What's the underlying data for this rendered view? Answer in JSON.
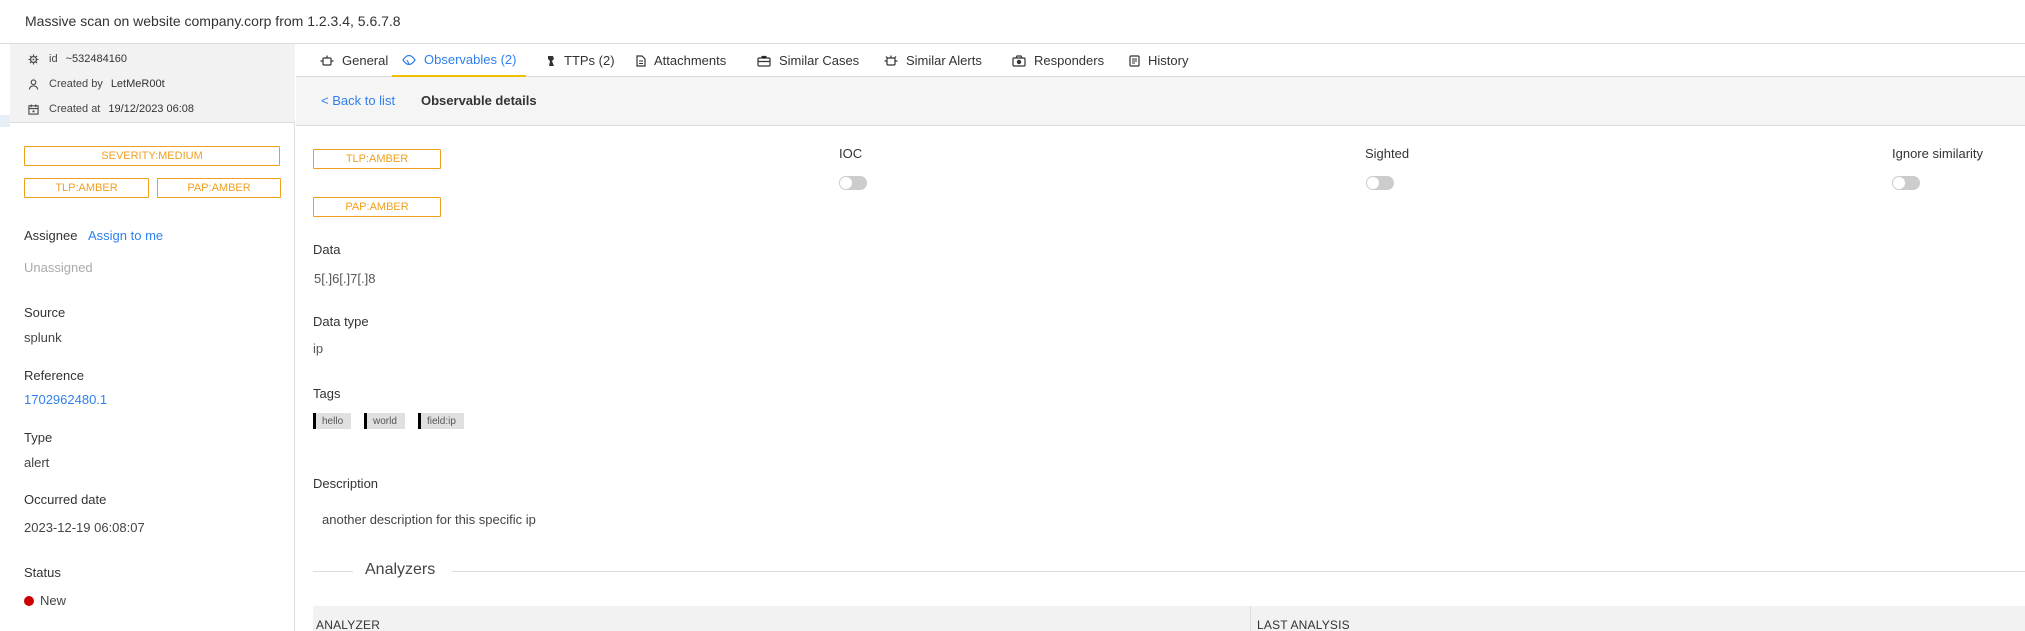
{
  "header": {
    "title": "Massive scan on website company.corp from 1.2.3.4, 5.6.7.8"
  },
  "sidebar": {
    "meta": {
      "id_label": "id",
      "id_value": "~532484160",
      "created_by_label": "Created by",
      "created_by_value": "LetMeR00t",
      "created_at_label": "Created at",
      "created_at_value": "19/12/2023 06:08"
    },
    "badges": {
      "severity": "SEVERITY:MEDIUM",
      "tlp": "TLP:AMBER",
      "pap": "PAP:AMBER"
    },
    "assignee_label": "Assignee",
    "assign_to_me": "Assign to me",
    "assignee_value": "Unassigned",
    "source_label": "Source",
    "source_value": "splunk",
    "reference_label": "Reference",
    "reference_value": "1702962480.1",
    "type_label": "Type",
    "type_value": "alert",
    "occurred_label": "Occurred date",
    "occurred_value": "2023-12-19 06:08:07",
    "status_label": "Status",
    "status_value": "New",
    "status_color": "#cc0000"
  },
  "tabs": [
    {
      "label": "General",
      "icon": "general-icon"
    },
    {
      "label": "Observables (2)",
      "icon": "observables-icon"
    },
    {
      "label": "TTPs (2)",
      "icon": "ttps-icon"
    },
    {
      "label": "Attachments",
      "icon": "attachments-icon"
    },
    {
      "label": "Similar Cases",
      "icon": "similar-cases-icon"
    },
    {
      "label": "Similar Alerts",
      "icon": "similar-alerts-icon"
    },
    {
      "label": "Responders",
      "icon": "responders-icon"
    },
    {
      "label": "History",
      "icon": "history-icon"
    }
  ],
  "active_tab": "Observables (2)",
  "subheader": {
    "back": "< Back to list",
    "title": "Observable details"
  },
  "observable": {
    "tlp": "TLP:AMBER",
    "pap": "PAP:AMBER",
    "ioc_label": "IOC",
    "ioc": false,
    "sighted_label": "Sighted",
    "sighted": false,
    "ignore_similarity_label": "Ignore similarity",
    "ignore_similarity": false,
    "data_label": "Data",
    "data_value": "5[.]6[.]7[.]8",
    "datatype_label": "Data type",
    "datatype_value": "ip",
    "tags_label": "Tags",
    "tags": [
      "hello",
      "world",
      "field:ip"
    ],
    "description_label": "Description",
    "description_value": "another description for this specific ip"
  },
  "analyzers": {
    "title": "Analyzers",
    "columns": [
      "ANALYZER",
      "LAST ANALYSIS"
    ]
  },
  "colors": {
    "accent": "#2f80ed",
    "amber": "#f0a020",
    "tab_underline": "#f0c000"
  }
}
